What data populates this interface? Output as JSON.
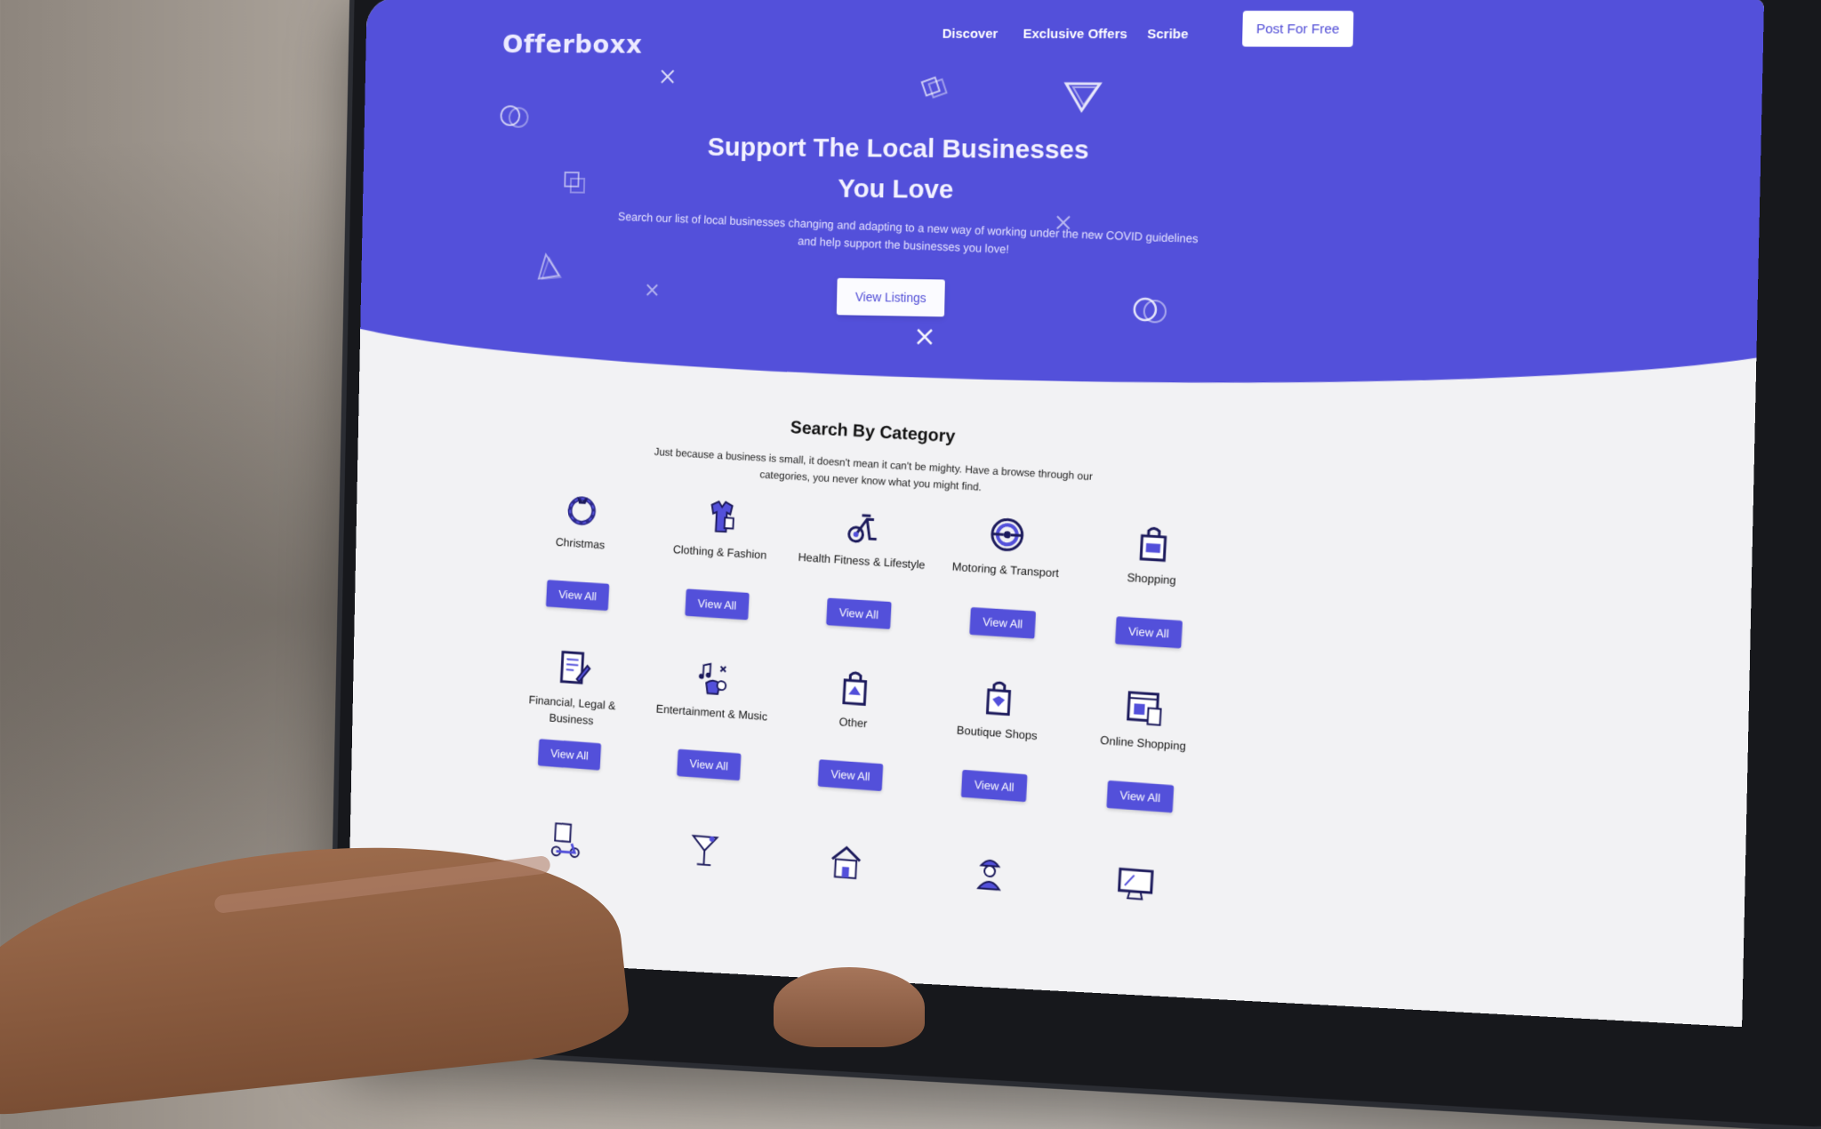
{
  "brand": {
    "logo": "Offerboxx",
    "accent": "#5350da"
  },
  "nav": {
    "links": [
      "Discover",
      "Exclusive Offers",
      "Scribe"
    ],
    "cta": "Post For Free"
  },
  "hero": {
    "title_line1": "Support The Local Businesses",
    "title_line2": "You Love",
    "subtitle": "Search our list of local businesses changing and adapting to a new way of working under the new COVID guidelines and help support the businesses you love!",
    "button": "View Listings"
  },
  "categories": {
    "title": "Search By Category",
    "description": "Just because a business is small, it doesn't mean it can't be mighty. Have a browse through our categories, you never know what you might find.",
    "button_label": "View All",
    "items": [
      {
        "name": "Christmas",
        "icon": "wreath-icon"
      },
      {
        "name": "Clothing & Fashion",
        "icon": "clothing-icon"
      },
      {
        "name": "Health Fitness & Lifestyle",
        "icon": "exercise-bike-icon"
      },
      {
        "name": "Motoring & Transport",
        "icon": "steering-wheel-icon"
      },
      {
        "name": "Shopping",
        "icon": "shopping-bag-icon"
      },
      {
        "name": "Financial, Legal & Business",
        "icon": "document-pen-icon"
      },
      {
        "name": "Entertainment & Music",
        "icon": "music-icon"
      },
      {
        "name": "Other",
        "icon": "bag-icon"
      },
      {
        "name": "Boutique Shops",
        "icon": "boutique-bag-icon"
      },
      {
        "name": "Online Shopping",
        "icon": "online-shop-icon"
      }
    ]
  }
}
